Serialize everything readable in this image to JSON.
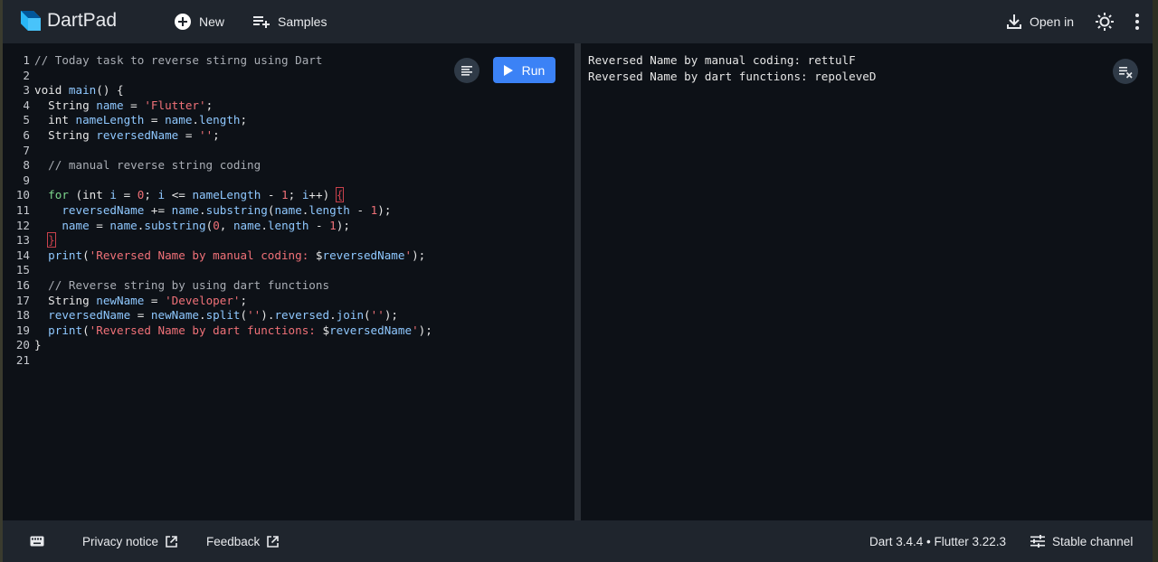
{
  "app": {
    "title": "DartPad"
  },
  "toolbar": {
    "new_label": "New",
    "samples_label": "Samples",
    "open_in_label": "Open in"
  },
  "editor": {
    "run_label": "Run",
    "lines": [
      {
        "n": "1",
        "tokens": [
          {
            "t": "// Today task to reverse stirng using Dart",
            "c": "cm"
          }
        ]
      },
      {
        "n": "2",
        "tokens": []
      },
      {
        "n": "3",
        "tokens": [
          {
            "t": "void ",
            "c": "kw"
          },
          {
            "t": "main",
            "c": "fn"
          },
          {
            "t": "() {",
            "c": "kw"
          }
        ]
      },
      {
        "n": "4",
        "tokens": [
          {
            "t": "  String ",
            "c": "kw"
          },
          {
            "t": "name",
            "c": "var"
          },
          {
            "t": " = ",
            "c": "kw"
          },
          {
            "t": "'Flutter'",
            "c": "str"
          },
          {
            "t": ";",
            "c": "kw"
          }
        ]
      },
      {
        "n": "5",
        "tokens": [
          {
            "t": "  int ",
            "c": "kw"
          },
          {
            "t": "nameLength",
            "c": "var"
          },
          {
            "t": " = ",
            "c": "kw"
          },
          {
            "t": "name",
            "c": "var"
          },
          {
            "t": ".",
            "c": "kw"
          },
          {
            "t": "length",
            "c": "var"
          },
          {
            "t": ";",
            "c": "kw"
          }
        ]
      },
      {
        "n": "6",
        "tokens": [
          {
            "t": "  String ",
            "c": "kw"
          },
          {
            "t": "reversedName",
            "c": "var"
          },
          {
            "t": " = ",
            "c": "kw"
          },
          {
            "t": "''",
            "c": "str"
          },
          {
            "t": ";",
            "c": "kw"
          }
        ]
      },
      {
        "n": "7",
        "tokens": []
      },
      {
        "n": "8",
        "tokens": [
          {
            "t": "  // manual reverse string coding",
            "c": "cm"
          }
        ]
      },
      {
        "n": "9",
        "tokens": []
      },
      {
        "n": "10",
        "tokens": [
          {
            "t": "  for",
            "c": "kwb"
          },
          {
            "t": " (int ",
            "c": "kw"
          },
          {
            "t": "i",
            "c": "var"
          },
          {
            "t": " = ",
            "c": "kw"
          },
          {
            "t": "0",
            "c": "num"
          },
          {
            "t": "; ",
            "c": "kw"
          },
          {
            "t": "i",
            "c": "var"
          },
          {
            "t": " <= ",
            "c": "kw"
          },
          {
            "t": "nameLength",
            "c": "var"
          },
          {
            "t": " - ",
            "c": "kw"
          },
          {
            "t": "1",
            "c": "num"
          },
          {
            "t": "; ",
            "c": "kw"
          },
          {
            "t": "i",
            "c": "var"
          },
          {
            "t": "++) ",
            "c": "kw"
          },
          {
            "t": "{",
            "c": "br"
          }
        ]
      },
      {
        "n": "11",
        "tokens": [
          {
            "t": "    reversedName",
            "c": "var"
          },
          {
            "t": " += ",
            "c": "kw"
          },
          {
            "t": "name",
            "c": "var"
          },
          {
            "t": ".",
            "c": "kw"
          },
          {
            "t": "substring",
            "c": "fn"
          },
          {
            "t": "(",
            "c": "kw"
          },
          {
            "t": "name",
            "c": "var"
          },
          {
            "t": ".",
            "c": "kw"
          },
          {
            "t": "length",
            "c": "var"
          },
          {
            "t": " - ",
            "c": "kw"
          },
          {
            "t": "1",
            "c": "num"
          },
          {
            "t": ");",
            "c": "kw"
          }
        ]
      },
      {
        "n": "12",
        "tokens": [
          {
            "t": "    name",
            "c": "var"
          },
          {
            "t": " = ",
            "c": "kw"
          },
          {
            "t": "name",
            "c": "var"
          },
          {
            "t": ".",
            "c": "kw"
          },
          {
            "t": "substring",
            "c": "fn"
          },
          {
            "t": "(",
            "c": "kw"
          },
          {
            "t": "0",
            "c": "num"
          },
          {
            "t": ", ",
            "c": "kw"
          },
          {
            "t": "name",
            "c": "var"
          },
          {
            "t": ".",
            "c": "kw"
          },
          {
            "t": "length",
            "c": "var"
          },
          {
            "t": " - ",
            "c": "kw"
          },
          {
            "t": "1",
            "c": "num"
          },
          {
            "t": ");",
            "c": "kw"
          }
        ]
      },
      {
        "n": "13",
        "tokens": [
          {
            "t": "  ",
            "c": "kw"
          },
          {
            "t": "}",
            "c": "br"
          }
        ]
      },
      {
        "n": "14",
        "tokens": [
          {
            "t": "  print",
            "c": "fn"
          },
          {
            "t": "(",
            "c": "kw"
          },
          {
            "t": "'Reversed Name by manual coding: ",
            "c": "str"
          },
          {
            "t": "$",
            "c": "kw"
          },
          {
            "t": "reversedName",
            "c": "var"
          },
          {
            "t": "'",
            "c": "str"
          },
          {
            "t": ");",
            "c": "kw"
          }
        ]
      },
      {
        "n": "15",
        "tokens": []
      },
      {
        "n": "16",
        "tokens": [
          {
            "t": "  // Reverse string by using dart functions",
            "c": "cm"
          }
        ]
      },
      {
        "n": "17",
        "tokens": [
          {
            "t": "  String ",
            "c": "kw"
          },
          {
            "t": "newName",
            "c": "var"
          },
          {
            "t": " = ",
            "c": "kw"
          },
          {
            "t": "'Developer'",
            "c": "str"
          },
          {
            "t": ";",
            "c": "kw"
          }
        ]
      },
      {
        "n": "18",
        "tokens": [
          {
            "t": "  reversedName",
            "c": "var"
          },
          {
            "t": " = ",
            "c": "kw"
          },
          {
            "t": "newName",
            "c": "var"
          },
          {
            "t": ".",
            "c": "kw"
          },
          {
            "t": "split",
            "c": "fn"
          },
          {
            "t": "(",
            "c": "kw"
          },
          {
            "t": "''",
            "c": "str"
          },
          {
            "t": ").",
            "c": "kw"
          },
          {
            "t": "reversed",
            "c": "var"
          },
          {
            "t": ".",
            "c": "kw"
          },
          {
            "t": "join",
            "c": "fn"
          },
          {
            "t": "(",
            "c": "kw"
          },
          {
            "t": "''",
            "c": "str"
          },
          {
            "t": ");",
            "c": "kw"
          }
        ]
      },
      {
        "n": "19",
        "tokens": [
          {
            "t": "  print",
            "c": "fn"
          },
          {
            "t": "(",
            "c": "kw"
          },
          {
            "t": "'Reversed Name by dart functions: ",
            "c": "str"
          },
          {
            "t": "$",
            "c": "kw"
          },
          {
            "t": "reversedName",
            "c": "var"
          },
          {
            "t": "'",
            "c": "str"
          },
          {
            "t": ");",
            "c": "kw"
          }
        ]
      },
      {
        "n": "20",
        "tokens": [
          {
            "t": "}",
            "c": "kw"
          }
        ]
      },
      {
        "n": "21",
        "tokens": []
      }
    ]
  },
  "output": {
    "lines": [
      "Reversed Name by manual coding: rettulF",
      "Reversed Name by dart functions: repoleveD"
    ]
  },
  "footer": {
    "privacy_label": "Privacy notice",
    "feedback_label": "Feedback",
    "version_label": "Dart 3.4.4 • Flutter 3.22.3",
    "channel_label": "Stable channel"
  }
}
